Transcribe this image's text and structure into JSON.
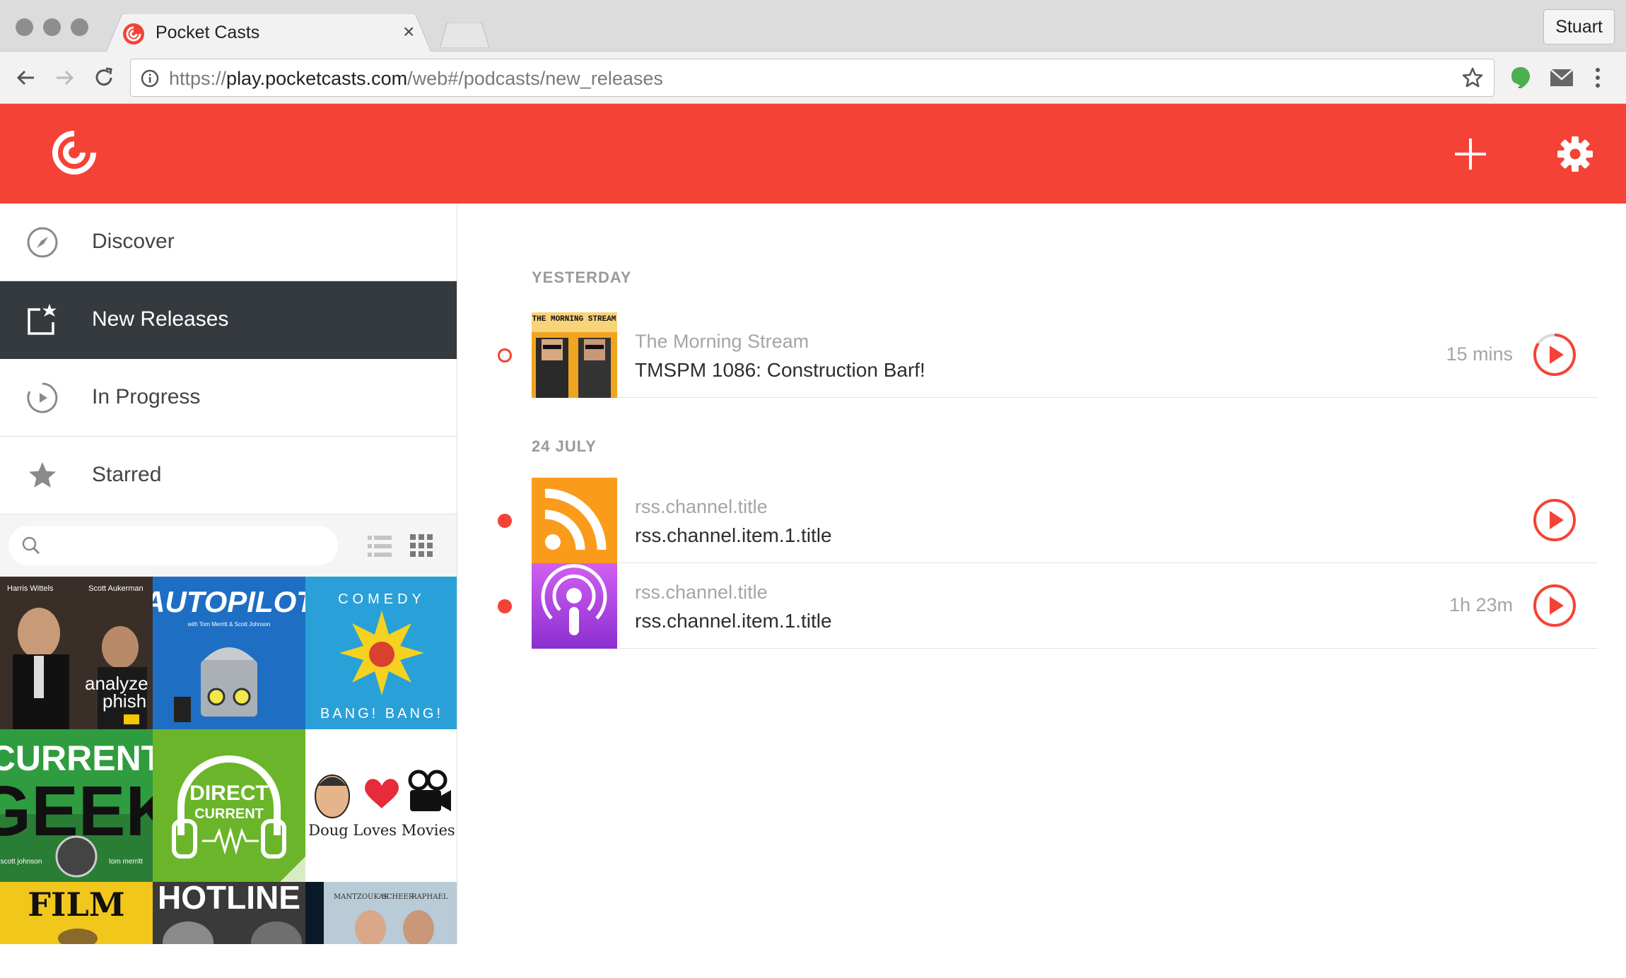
{
  "browser": {
    "tab_title": "Pocket Casts",
    "close_glyph": "×",
    "profile_name": "Stuart",
    "url_scheme": "https://",
    "url_host": "play.pocketcasts.com",
    "url_path": "/web#/podcasts/new_releases"
  },
  "app": {
    "brand_color": "#f44336",
    "sidebar_active_color": "#353a3f"
  },
  "sidebar": {
    "items": [
      {
        "label": "Discover",
        "icon": "compass-icon",
        "active": false
      },
      {
        "label": "New Releases",
        "icon": "new-releases-icon",
        "active": true
      },
      {
        "label": "In Progress",
        "icon": "in-progress-icon",
        "active": false
      },
      {
        "label": "Starred",
        "icon": "star-icon",
        "active": false
      }
    ],
    "search": {
      "placeholder": "",
      "value": ""
    },
    "podcasts": [
      {
        "name": "Analyze Phish",
        "lines": [
          "Harris Wittels",
          "Scott Aukerman",
          "analyze",
          "phish"
        ]
      },
      {
        "name": "Autopilot",
        "lines": [
          "AUTOPILOT",
          "with Tom Merritt & Scott Johnson"
        ]
      },
      {
        "name": "Comedy Bang! Bang!",
        "lines": [
          "COMEDY",
          "BANG! BANG!"
        ]
      },
      {
        "name": "Current Geek",
        "lines": [
          "CURRENT",
          "GEEK",
          "scott johnson",
          "tom merritt"
        ]
      },
      {
        "name": "Direct Current",
        "lines": [
          "DIRECT",
          "CURRENT"
        ]
      },
      {
        "name": "Doug Loves Movies",
        "lines": [
          "Doug Loves Movies"
        ]
      },
      {
        "name": "Film",
        "lines": [
          "FILM"
        ]
      },
      {
        "name": "Hotline",
        "lines": [
          "HOTLINE"
        ]
      },
      {
        "name": "Mantzoukas Scheer Raphael",
        "lines": [
          "MANTZOUKAS",
          "SCHEER",
          "RAPHAEL"
        ]
      }
    ]
  },
  "main": {
    "sections": [
      {
        "heading": "YESTERDAY",
        "episodes": [
          {
            "podcast": "The Morning Stream",
            "title": "TMSPM 1086: Construction Barf!",
            "duration": "15 mins",
            "status": "ring",
            "art": "morning-stream",
            "art_text": "THE MORNING STREAM"
          }
        ]
      },
      {
        "heading": "24 JULY",
        "episodes": [
          {
            "podcast": "rss.channel.title",
            "title": "rss.channel.item.1.title",
            "duration": "",
            "status": "filled",
            "art": "rss"
          },
          {
            "podcast": "rss.channel.title",
            "title": "rss.channel.item.1.title",
            "duration": "1h 23m",
            "status": "filled",
            "art": "podcast"
          }
        ]
      }
    ]
  }
}
